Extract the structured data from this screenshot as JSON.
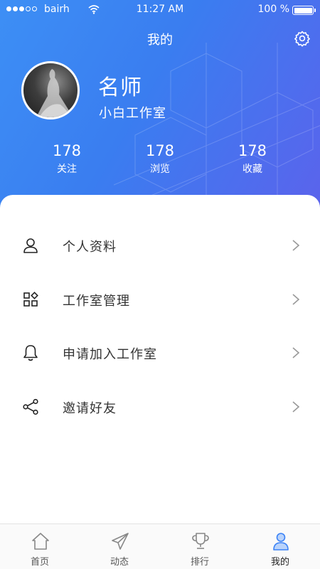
{
  "status_bar": {
    "carrier": "bairh",
    "time": "11:27 AM",
    "battery": "100 %"
  },
  "header": {
    "title": "我的",
    "settings_icon": "gear-icon"
  },
  "profile": {
    "name": "名师",
    "studio": "小白工作室"
  },
  "stats": [
    {
      "value": "178",
      "label": "关注"
    },
    {
      "value": "178",
      "label": "浏览"
    },
    {
      "value": "178",
      "label": "收藏"
    }
  ],
  "menu": [
    {
      "label": "个人资料",
      "icon": "user-icon"
    },
    {
      "label": "工作室管理",
      "icon": "grid-icon"
    },
    {
      "label": "申请加入工作室",
      "icon": "bell-icon"
    },
    {
      "label": "邀请好友",
      "icon": "share-icon"
    }
  ],
  "tabs": [
    {
      "label": "首页",
      "icon": "home-icon"
    },
    {
      "label": "动态",
      "icon": "send-icon"
    },
    {
      "label": "排行",
      "icon": "trophy-icon"
    },
    {
      "label": "我的",
      "icon": "profile-icon",
      "active": true
    }
  ],
  "colors": {
    "header_start": "#3d8ff5",
    "header_end": "#5b63ec",
    "accent": "#3b82f6"
  }
}
